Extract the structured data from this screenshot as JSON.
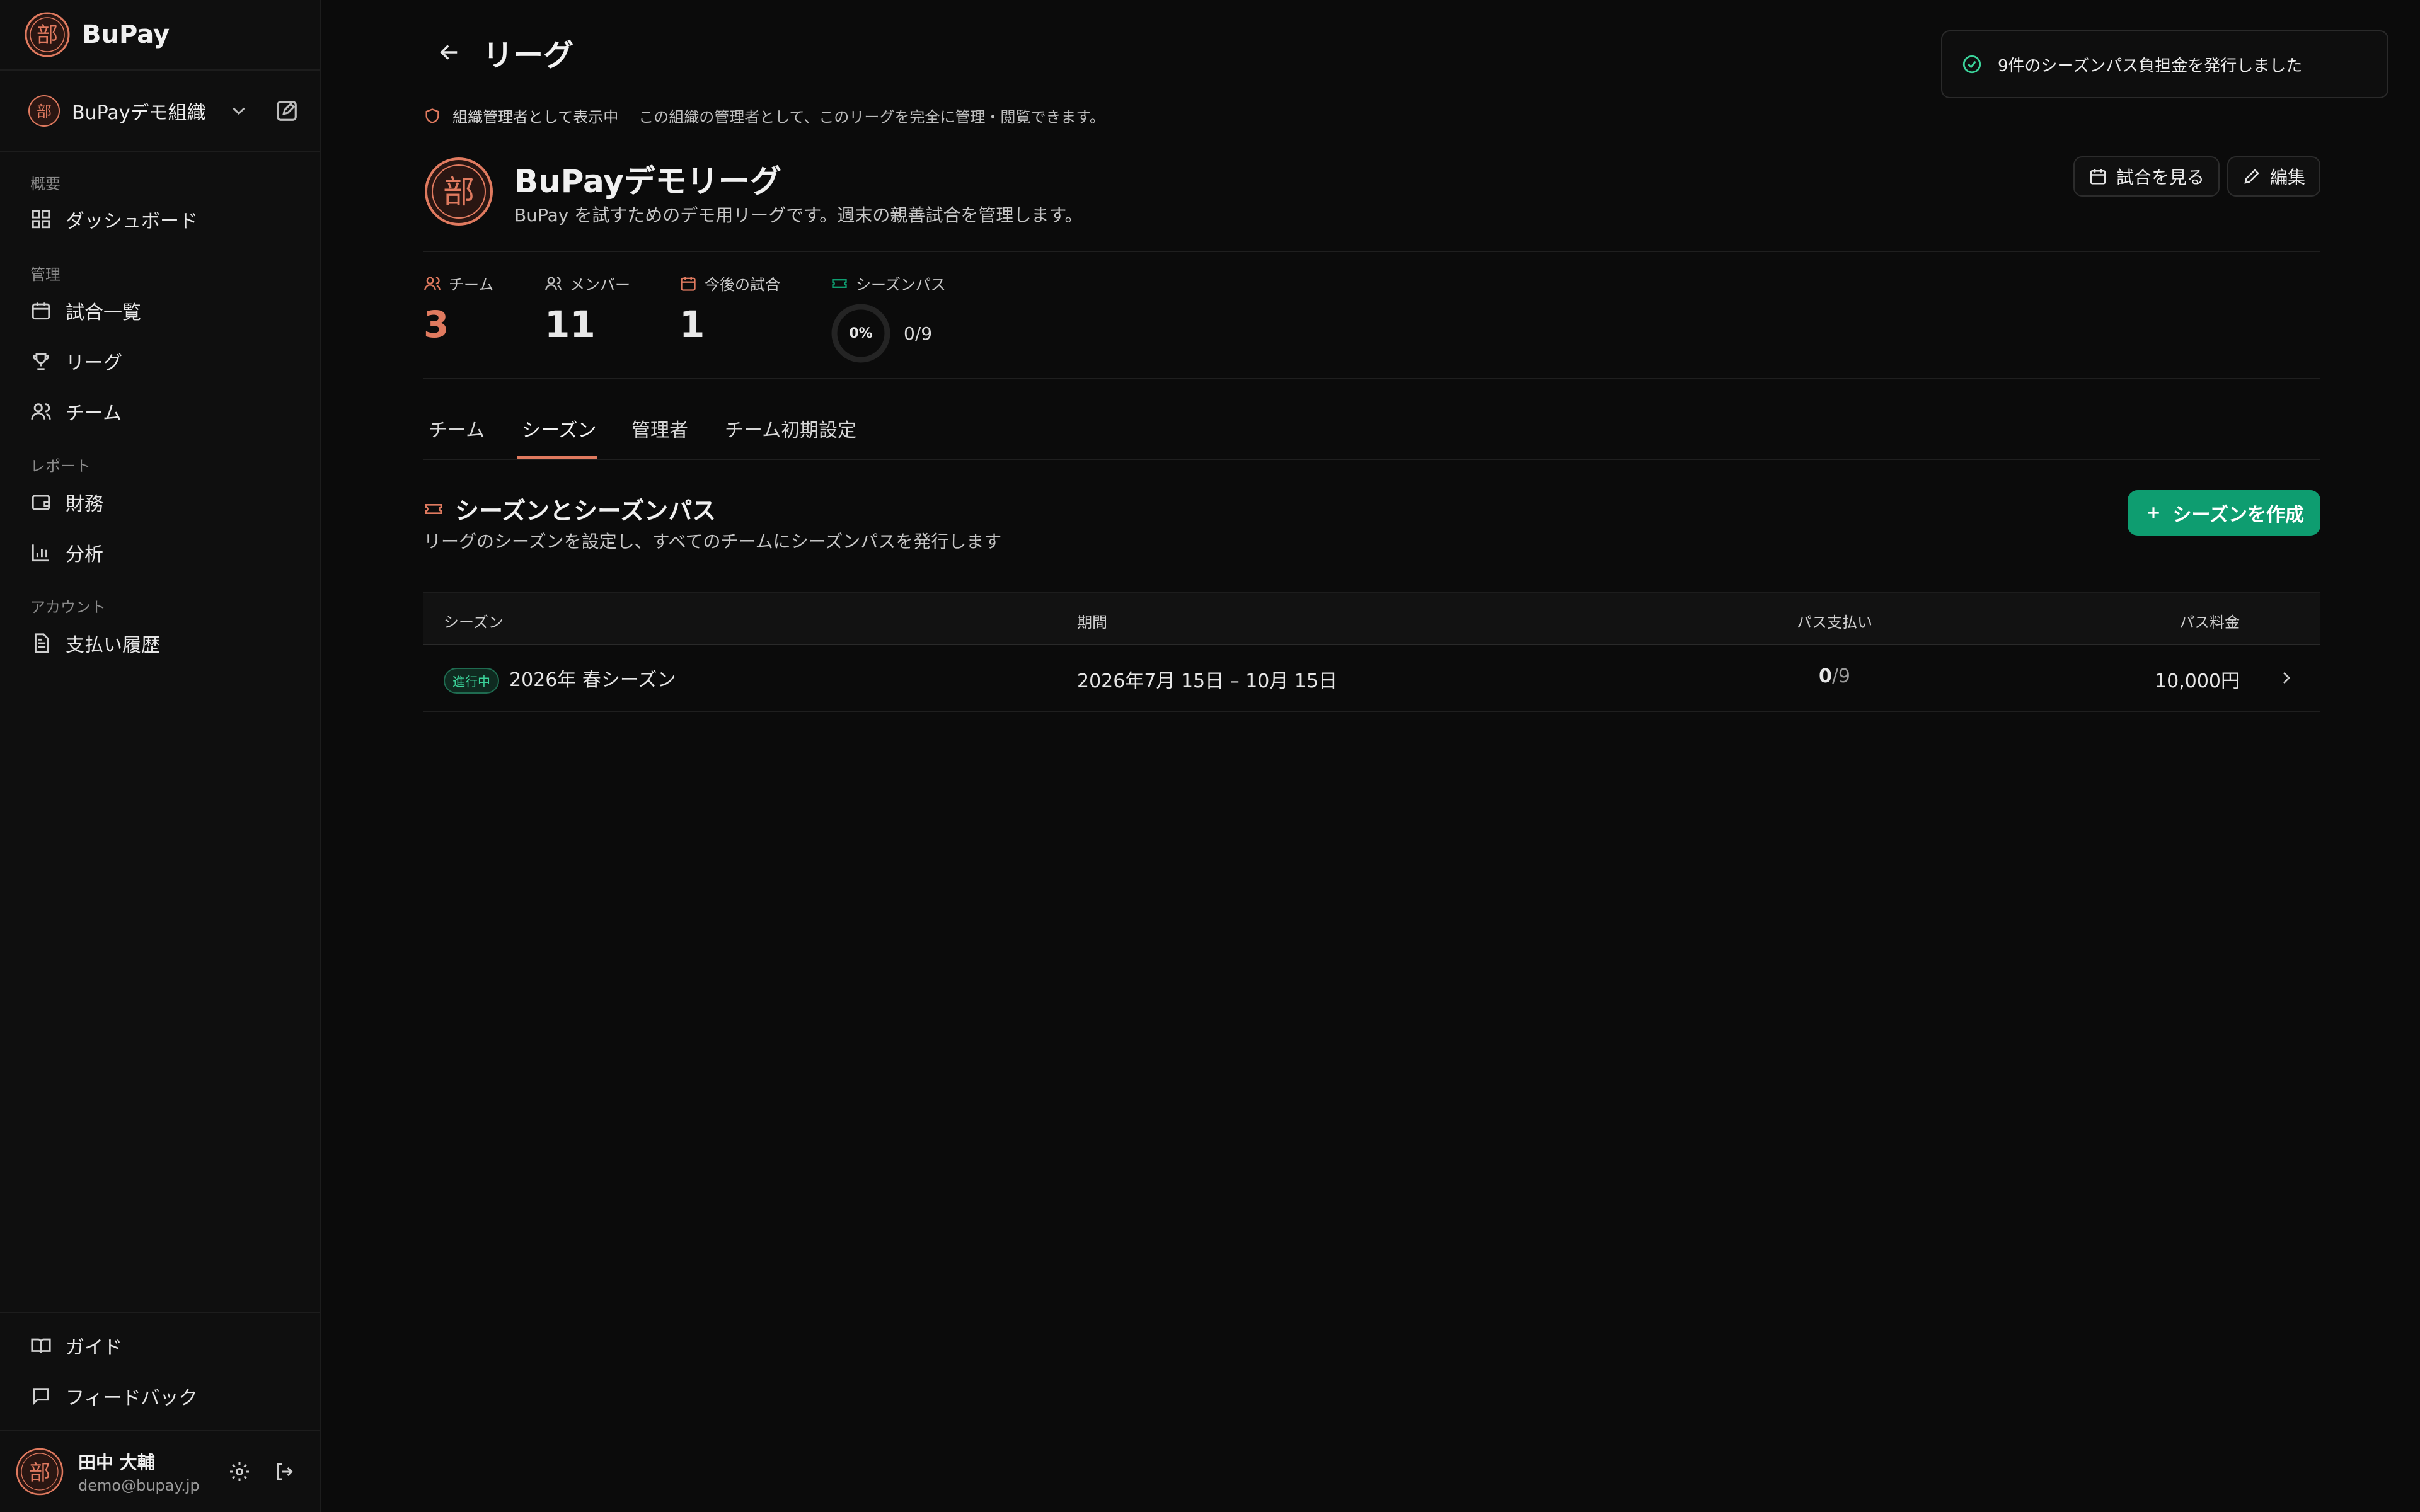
{
  "app": {
    "name": "BuPay"
  },
  "sidebar": {
    "org_name": "BuPayデモ組織",
    "groups": [
      {
        "label": "概要"
      },
      {
        "label": "管理"
      },
      {
        "label": "レポート"
      },
      {
        "label": "アカウント"
      }
    ],
    "items": [
      {
        "label": "ダッシュボード",
        "icon": "dashboard-icon"
      },
      {
        "label": "試合一覧",
        "icon": "calendar-icon"
      },
      {
        "label": "リーグ",
        "icon": "trophy-icon"
      },
      {
        "label": "チーム",
        "icon": "users-icon"
      },
      {
        "label": "財務",
        "icon": "wallet-icon"
      },
      {
        "label": "分析",
        "icon": "chart-icon"
      },
      {
        "label": "支払い履歴",
        "icon": "document-icon"
      }
    ],
    "footer_items": [
      {
        "label": "ガイド",
        "icon": "book-icon"
      },
      {
        "label": "フィードバック",
        "icon": "message-icon"
      }
    ],
    "user": {
      "name": "田中 大輔",
      "email": "demo@bupay.jp"
    }
  },
  "header": {
    "title": "リーグ"
  },
  "notice": {
    "label": "組織管理者として表示中",
    "text": "この組織の管理者として、このリーグを完全に管理・閲覧できます。"
  },
  "league": {
    "name": "BuPayデモリーグ",
    "description": "BuPay を試すためのデモ用リーグです。週末の親善試合を管理します。",
    "view_matches_label": "試合を見る",
    "edit_label": "編集"
  },
  "stats": {
    "teams": {
      "label": "チーム",
      "value": "3"
    },
    "members": {
      "label": "メンバー",
      "value": "11"
    },
    "upcoming": {
      "label": "今後の試合",
      "value": "1"
    },
    "season_pass": {
      "label": "シーズンパス",
      "percent_text": "0%",
      "count_text": "0/9",
      "fraction": 0
    }
  },
  "tabs": [
    {
      "label": "チーム"
    },
    {
      "label": "シーズン",
      "active": true
    },
    {
      "label": "管理者"
    },
    {
      "label": "チーム初期設定"
    }
  ],
  "section": {
    "title": "シーズンとシーズンパス",
    "description": "リーグのシーズンを設定し、すべてのチームにシーズンパスを発行します",
    "create_label": "シーズンを作成"
  },
  "table": {
    "headers": {
      "season": "シーズン",
      "period": "期間",
      "payments": "パス支払い",
      "fee": "パス料金"
    },
    "rows": [
      {
        "status": "進行中",
        "season": "2026年 春シーズン",
        "period": "2026年7月 15日 – 10月 15日",
        "paid": "0",
        "total": "/9",
        "fee": "10,000円"
      }
    ]
  },
  "toast": {
    "text": "9件のシーズンパス負担金を発行しました"
  },
  "colors": {
    "accent": "#e07a5f",
    "primary_button": "#0e9d70",
    "status_green": "#3bd39a",
    "background": "#0b0b0b"
  }
}
